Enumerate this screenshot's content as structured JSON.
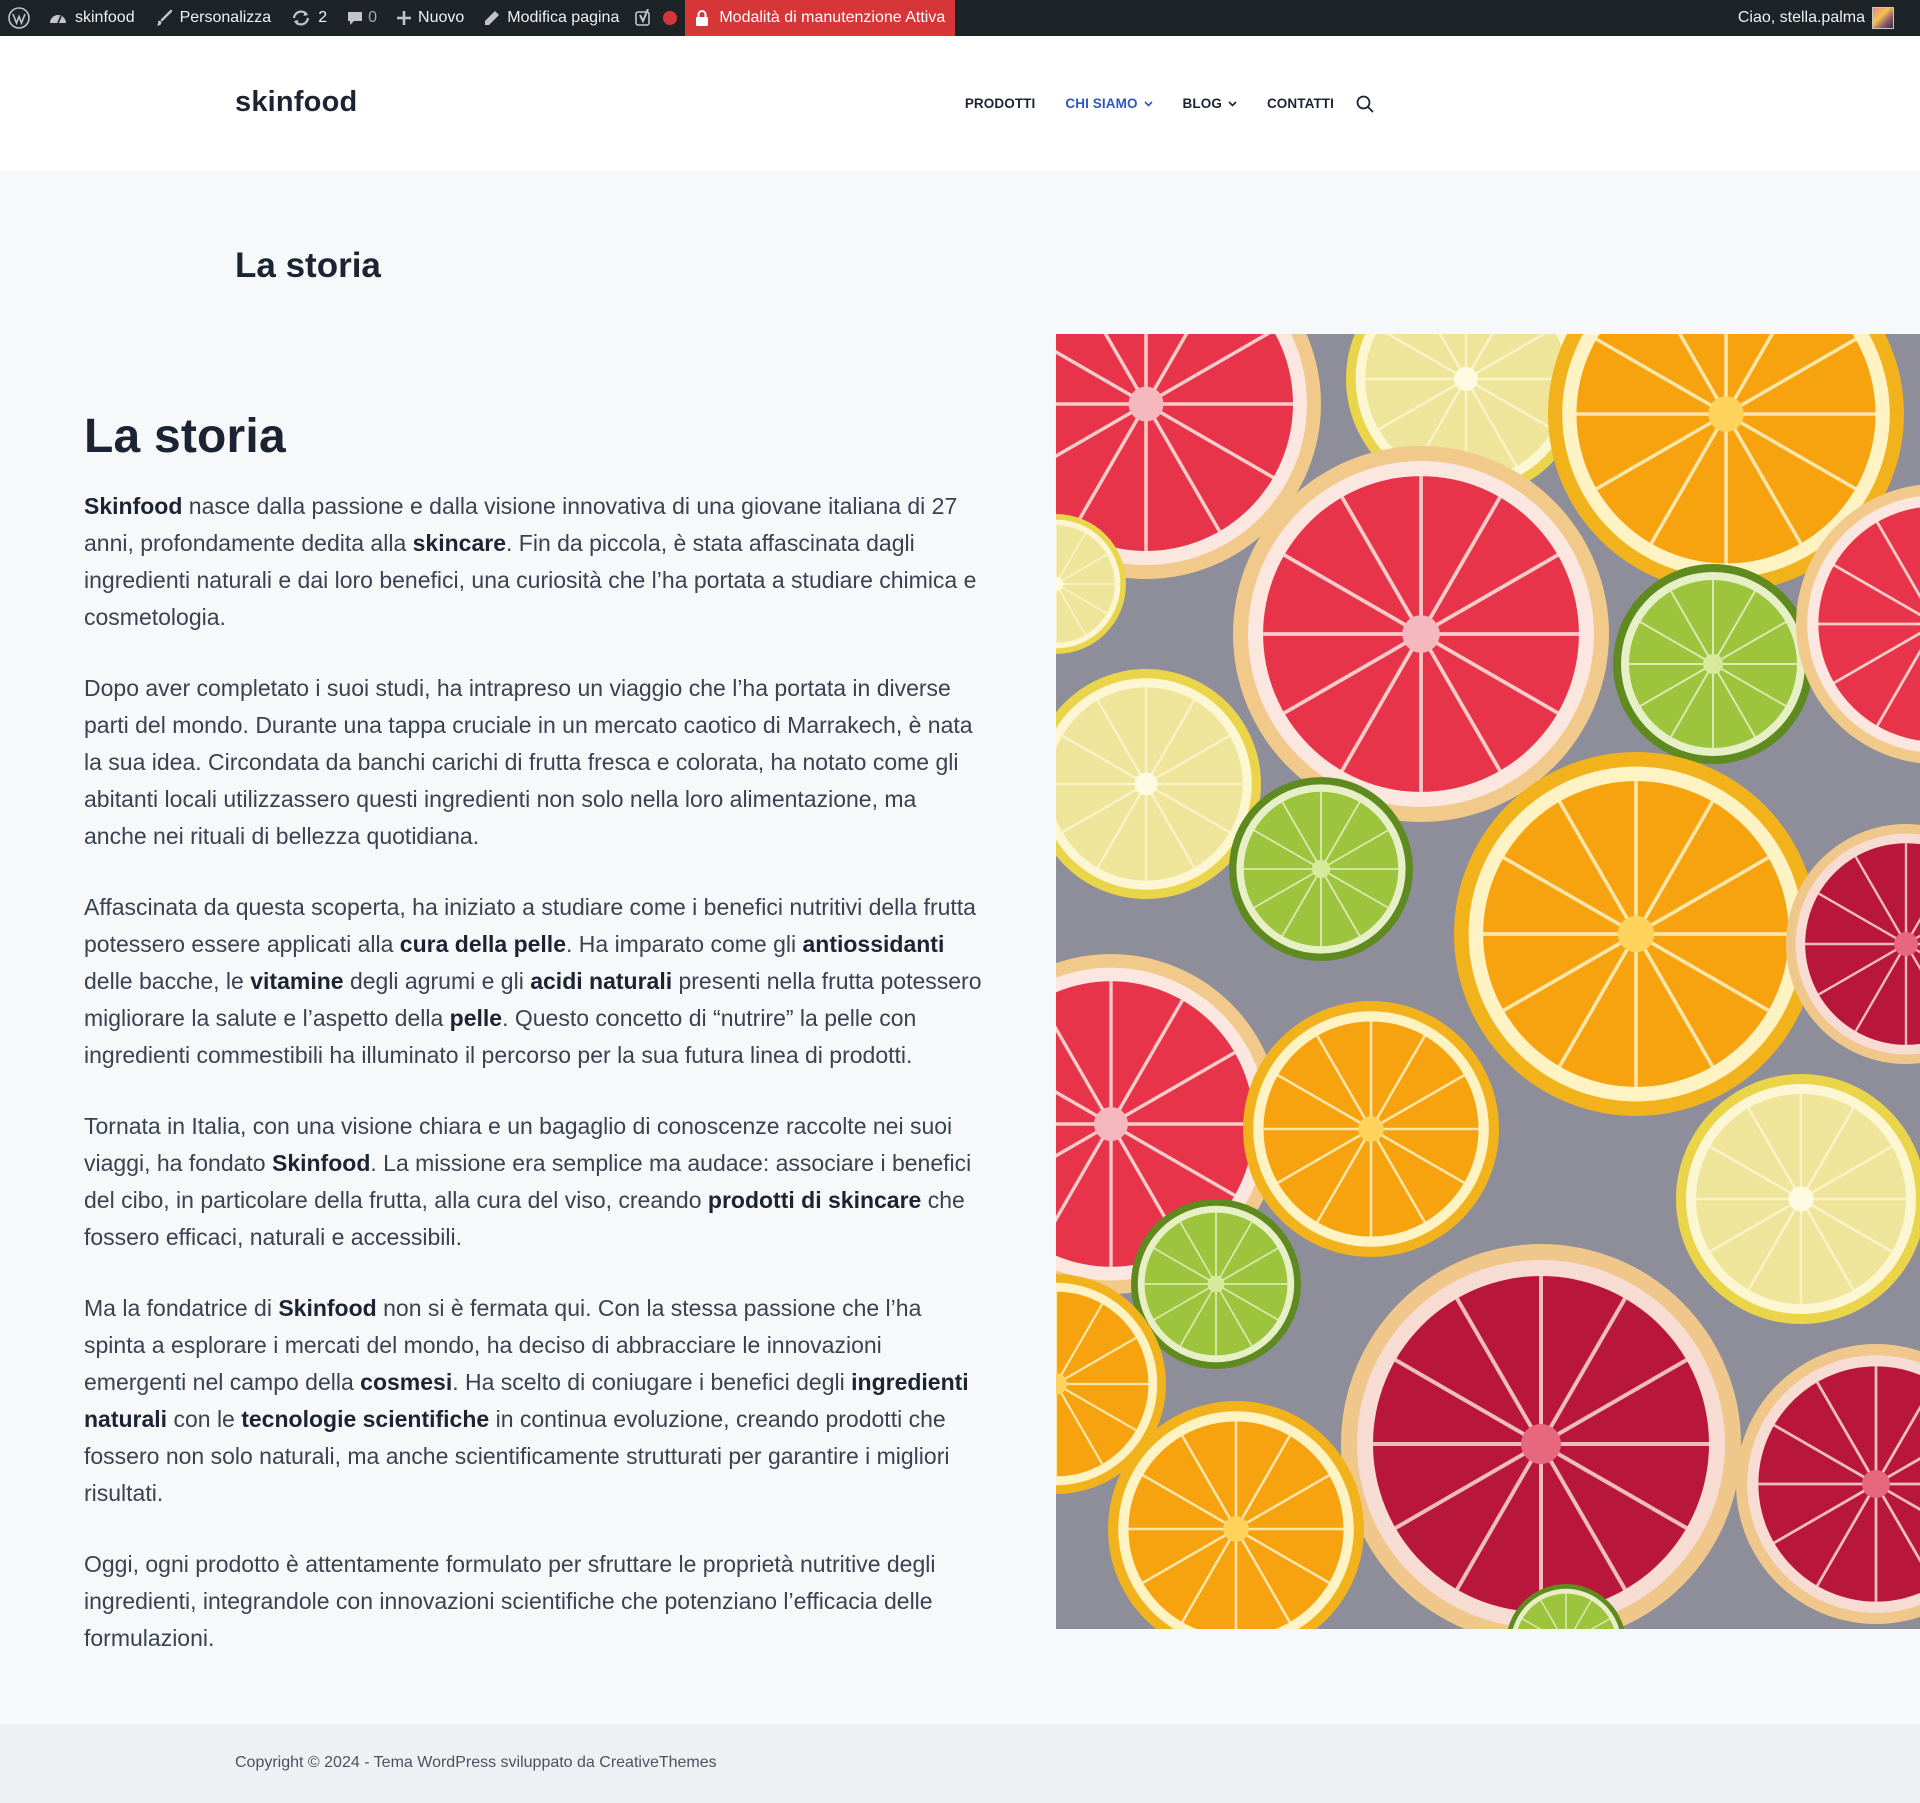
{
  "admin_bar": {
    "site_name": "skinfood",
    "customize": "Personalizza",
    "updates_count": "2",
    "comments_count": "0",
    "new_label": "Nuovo",
    "edit_page": "Modifica pagina",
    "maintenance": "Modalità di manutenzione Attiva",
    "greeting": "Ciao, stella.palma"
  },
  "header": {
    "logo": "skinfood",
    "nav": [
      {
        "label": "PRODOTTI",
        "active": false,
        "dropdown": false
      },
      {
        "label": "CHI SIAMO",
        "active": true,
        "dropdown": true
      },
      {
        "label": "BLOG",
        "active": false,
        "dropdown": true
      },
      {
        "label": "CONTATTI",
        "active": false,
        "dropdown": false
      }
    ]
  },
  "page": {
    "title": "La storia",
    "heading": "La storia",
    "paragraphs": [
      "<b>Skinfood</b> nasce dalla passione e dalla visione innovativa di una giovane italiana di 27 anni, profondamente dedita alla <b>skincare</b>. Fin da piccola, è stata affascinata dagli ingredienti naturali e dai loro benefici, una curiosità che l’ha portata a studiare chimica e cosmetologia.",
      "Dopo aver completato i suoi studi, ha intrapreso un viaggio che l’ha portata in diverse parti del mondo. Durante una tappa cruciale in un mercato caotico di Marrakech, è nata la sua idea. Circondata da banchi carichi di frutta fresca e colorata, ha notato come gli abitanti locali utilizzassero questi ingredienti non solo nella loro alimentazione, ma anche nei rituali di bellezza quotidiana.",
      "Affascinata da questa scoperta, ha iniziato a studiare come i benefici nutritivi della frutta potessero essere applicati alla <b>cura della pelle</b>. Ha imparato come gli <b>antiossidanti</b> delle bacche, le <b>vitamine</b> degli agrumi e gli <b>acidi naturali</b> presenti nella frutta potessero migliorare la salute e l’aspetto della <b>pelle</b>. Questo concetto di “nutrire” la pelle con ingredienti commestibili ha illuminato il percorso per la sua futura linea di prodotti.",
      "Tornata in Italia, con una visione chiara e un bagaglio di conoscenze raccolte nei suoi viaggi, ha fondato <b>Skinfood</b>. La missione era semplice ma audace: associare i benefici del cibo, in particolare della frutta, alla cura del viso, creando <b>prodotti di skincare</b> che fossero efficaci, naturali e accessibili.",
      "Ma la fondatrice di <b>Skinfood</b> non si è fermata qui. Con la stessa passione che l’ha spinta a esplorare i mercati del mondo, ha deciso di abbracciare le innovazioni emergenti nel campo della <b>cosmesi</b>. Ha scelto di coniugare i benefici degli <b>ingredienti naturali</b> con le <b>tecnologie scientifiche</b> in continua evoluzione, creando prodotti che fossero non solo naturali, ma anche scientificamente strutturati per garantire i migliori risultati.",
      "Oggi, ogni prodotto è attentamente formulato per sfruttare le proprietà nutritive degli ingredienti, integrandole con innovazioni scientifiche che potenziano l’efficacia delle formulazioni."
    ]
  },
  "footer": {
    "copyright": "Copyright © 2024 - Tema WordPress sviluppato da CreativeThemes"
  },
  "colors": {
    "admin_bar_bg": "#1d2327",
    "maintenance_bg": "#d63638",
    "nav_active": "#2b58c6",
    "text_dark": "#1c2434",
    "page_bg": "#f7f8fa"
  }
}
